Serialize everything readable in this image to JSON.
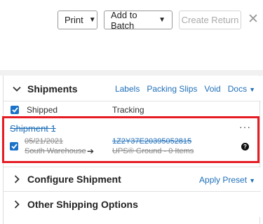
{
  "toolbar": {
    "print_label": "Print",
    "add_to_batch_label": "Add to Batch",
    "create_return_label": "Create Return",
    "close_glyph": "✕"
  },
  "shipments": {
    "title": "Shipments",
    "links": {
      "labels": "Labels",
      "packing_slips": "Packing Slips",
      "void": "Void",
      "docs": "Docs"
    },
    "columns": {
      "shipped": "Shipped",
      "tracking": "Tracking"
    },
    "items": [
      {
        "name": "Shipment 1",
        "date": "05/21/2021",
        "warehouse": "South Warehouse",
        "tracking_number": "1Z2Y37E20395052815",
        "method": "UPS® Ground - 0 Items",
        "checked": true
      }
    ]
  },
  "configure": {
    "title": "Configure Shipment",
    "apply_preset": "Apply Preset"
  },
  "other": {
    "title": "Other Shipping Options"
  },
  "colors": {
    "accent": "#1f6fb8",
    "checkbox": "#1a73c8",
    "highlight": "#e51c23"
  }
}
